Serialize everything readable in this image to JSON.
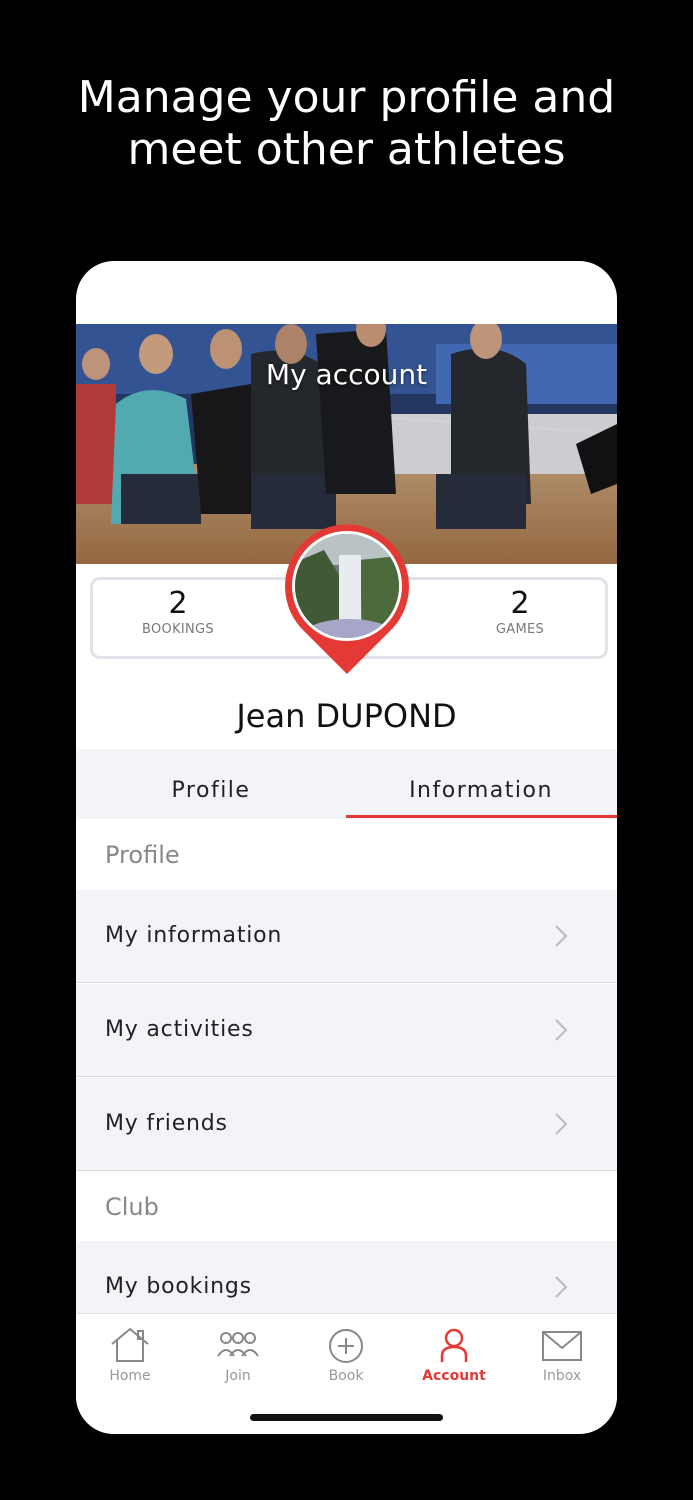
{
  "headline": {
    "line1": "Manage your profile and",
    "line2": "meet other athletes"
  },
  "header": {
    "title": "My account"
  },
  "stats": {
    "bookings": {
      "value": "2",
      "label": "BOOKINGS"
    },
    "games": {
      "value": "2",
      "label": "GAMES"
    }
  },
  "user": {
    "name": "Jean  DUPOND"
  },
  "tabs": [
    {
      "label": "Profile"
    },
    {
      "label": "Information",
      "active": true
    }
  ],
  "sections": {
    "profile": {
      "title": "Profile",
      "items": [
        {
          "label": "My information"
        },
        {
          "label": "My activities"
        },
        {
          "label": "My friends"
        }
      ]
    },
    "club": {
      "title": "Club",
      "items": [
        {
          "label": "My bookings"
        }
      ]
    }
  },
  "tabbar": [
    {
      "label": "Home",
      "icon": "home-icon"
    },
    {
      "label": "Join",
      "icon": "people-icon"
    },
    {
      "label": "Book",
      "icon": "plus-circle-icon"
    },
    {
      "label": "Account",
      "icon": "user-icon",
      "active": true
    },
    {
      "label": "Inbox",
      "icon": "mail-icon"
    }
  ],
  "colors": {
    "accent": "#e53935",
    "background": "#000000",
    "list_bg": "#f3f4f7"
  }
}
